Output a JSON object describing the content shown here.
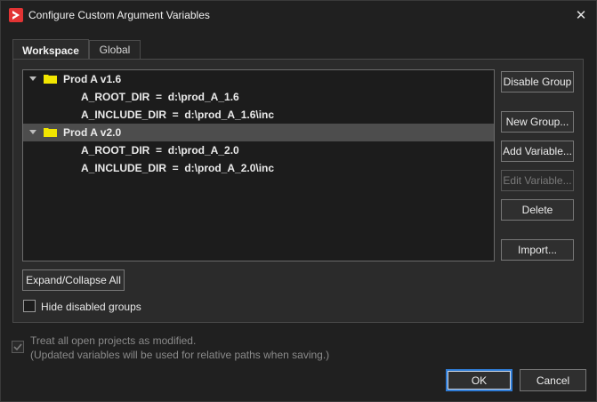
{
  "window": {
    "title": "Configure Custom Argument Variables",
    "close_glyph": "✕",
    "app_icon": "app-logo-icon",
    "accent": "#e23434"
  },
  "tabs": [
    {
      "label": "Workspace",
      "active": true
    },
    {
      "label": "Global",
      "active": false
    }
  ],
  "tree": {
    "groups": [
      {
        "name": "Prod A v1.6",
        "selected": false,
        "variables": [
          "A_ROOT_DIR  =  d:\\prod_A_1.6",
          "A_INCLUDE_DIR  =  d:\\prod_A_1.6\\inc"
        ]
      },
      {
        "name": "Prod A v2.0",
        "selected": true,
        "variables": [
          "A_ROOT_DIR  =  d:\\prod_A_2.0",
          "A_INCLUDE_DIR  =  d:\\prod_A_2.0\\inc"
        ]
      }
    ]
  },
  "side_buttons": {
    "disable_group": "Disable Group",
    "new_group": "New Group...",
    "add_variable": "Add Variable...",
    "edit_variable": "Edit Variable...",
    "delete": "Delete",
    "import": "Import..."
  },
  "expand_collapse_label": "Expand/Collapse All",
  "hide_disabled": {
    "label": "Hide disabled groups",
    "checked": false
  },
  "treat_modified": {
    "line1": "Treat all open projects as modified.",
    "line2": "(Updated variables will be used for relative paths when saving.)",
    "checked": true,
    "enabled": false
  },
  "footer": {
    "ok_label": "OK",
    "cancel_label": "Cancel"
  },
  "colors": {
    "folder": "#f2e600",
    "selection": "#4d4d4d",
    "focus": "#2f7cd6"
  }
}
